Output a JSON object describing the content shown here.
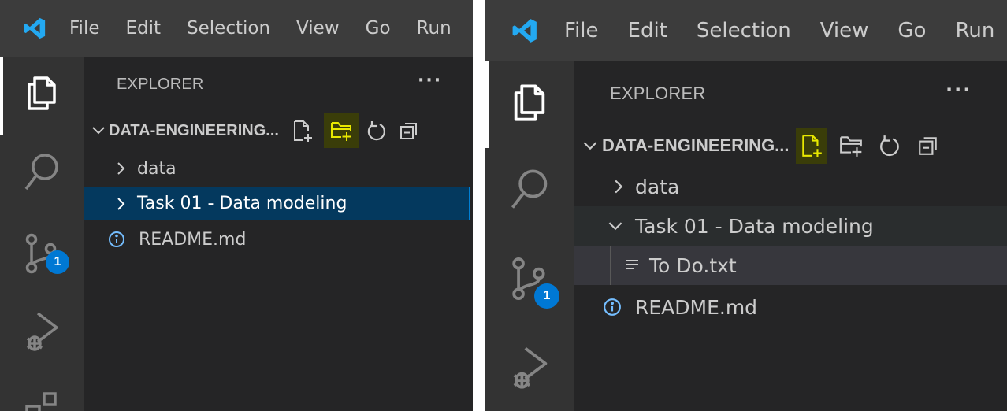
{
  "left": {
    "menu": [
      "File",
      "Edit",
      "Selection",
      "View",
      "Go",
      "Run"
    ],
    "explorer_title": "EXPLORER",
    "more_actions": "···",
    "folder_name": "DATA-ENGINEERING...",
    "tree": [
      {
        "label": "data",
        "kind": "folder-collapsed"
      },
      {
        "label": "Task 01 - Data modeling",
        "kind": "folder-collapsed",
        "selected": true
      },
      {
        "label": "README.md",
        "kind": "info-file"
      }
    ],
    "scm_badge": "1",
    "highlighted_action": "new-folder"
  },
  "right": {
    "menu": [
      "File",
      "Edit",
      "Selection",
      "View",
      "Go",
      "Run"
    ],
    "explorer_title": "EXPLORER",
    "more_actions": "···",
    "folder_name": "DATA-ENGINEERING...",
    "tree": [
      {
        "label": "data",
        "kind": "folder-collapsed"
      },
      {
        "label": "Task 01 - Data modeling",
        "kind": "folder-expanded"
      },
      {
        "label": "To Do.txt",
        "kind": "text-file"
      },
      {
        "label": "README.md",
        "kind": "info-file"
      }
    ],
    "scm_badge": "1",
    "highlighted_action": "new-file"
  },
  "colors": {
    "titlebar": "#3c3c3c",
    "activitybar": "#333333",
    "sidebar": "#252526",
    "selection": "#04395e",
    "focus_border": "#007fd4",
    "highlight": "#e8e800",
    "badge": "#0078d4",
    "vscode_blue": "#23a9f2"
  }
}
